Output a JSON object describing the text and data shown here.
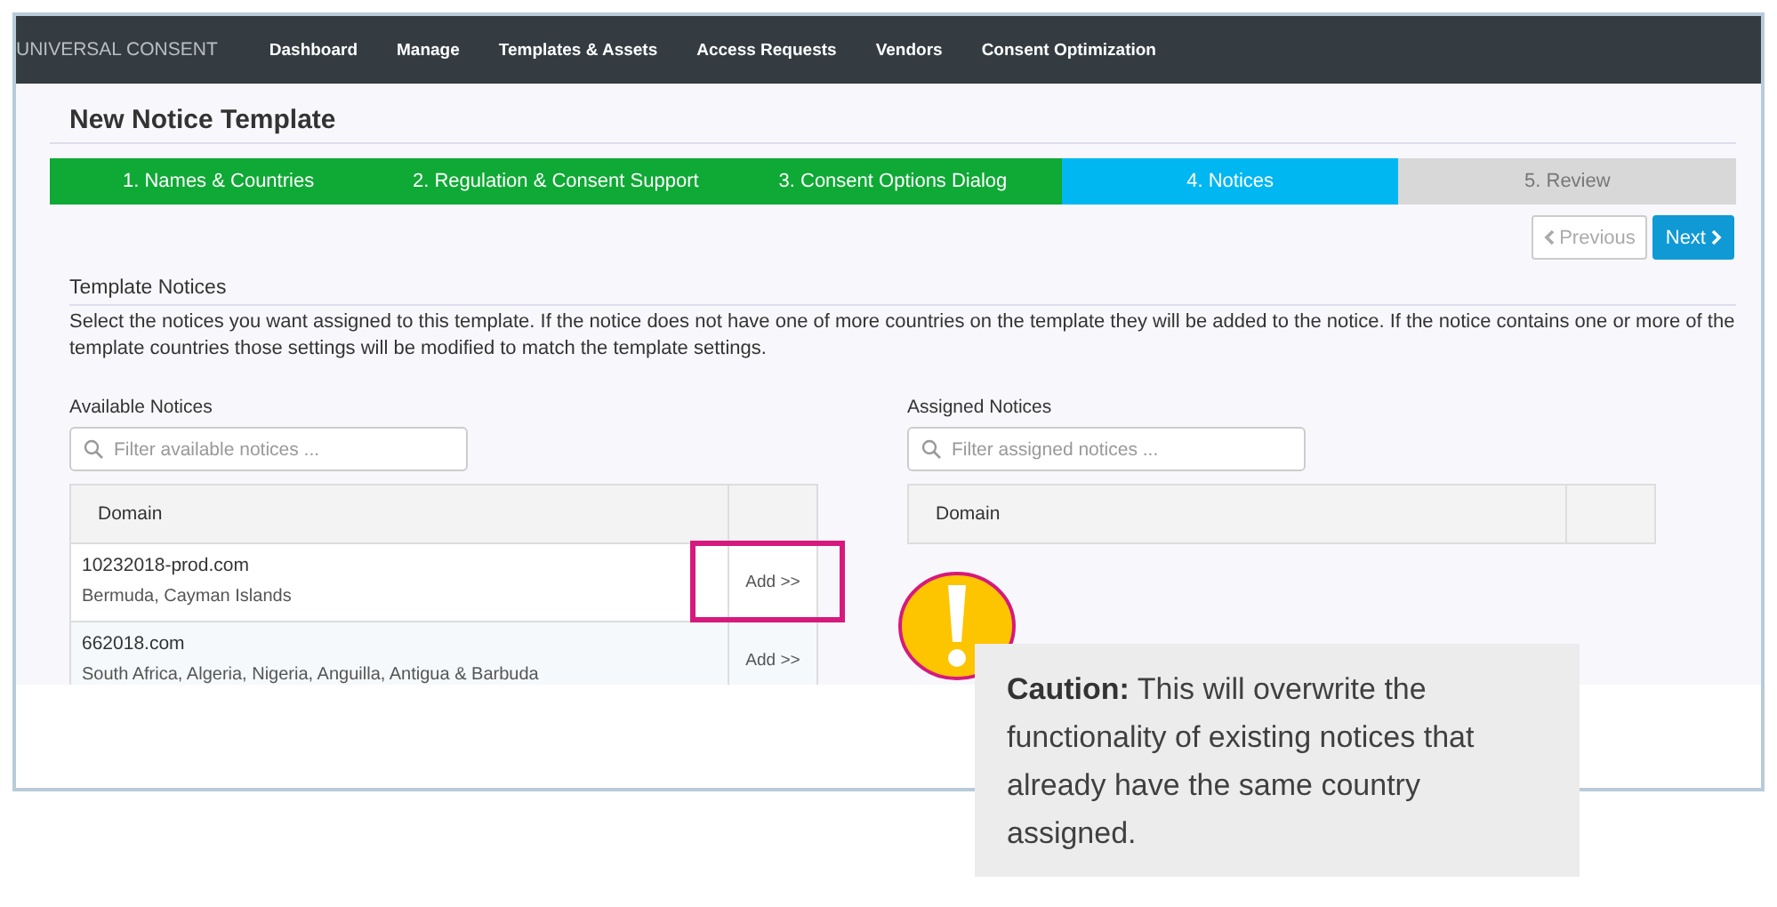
{
  "nav": {
    "brand": "UNIVERSAL CONSENT",
    "items": [
      "Dashboard",
      "Manage",
      "Templates & Assets",
      "Access Requests",
      "Vendors",
      "Consent Optimization"
    ]
  },
  "page_title": "New Notice Template",
  "steps": [
    {
      "label": "1. Names & Countries",
      "completed": true,
      "selected": false
    },
    {
      "label": "2. Regulation & Consent Support",
      "completed": true,
      "selected": false
    },
    {
      "label": "3. Consent Options Dialog",
      "completed": true,
      "selected": false
    },
    {
      "label": "4. Notices",
      "completed": false,
      "selected": true
    },
    {
      "label": "5. Review",
      "completed": false,
      "selected": false
    }
  ],
  "previous_button": {
    "label": "Previous",
    "disabled": true
  },
  "next_button": {
    "label": "Next",
    "disabled": false
  },
  "section": {
    "title": "Template Notices",
    "description": "Select the notices you want assigned to this template. If the notice does not have one of more countries on the template they will be added to the notice. If the notice contains one or more of the template countries those settings will be modified to match the template settings."
  },
  "available": {
    "title": "Available Notices",
    "placeholder": "Filter available notices ...",
    "columns": [
      "Domain"
    ],
    "rows": [
      {
        "domain": "10232018-prod.com",
        "countries": "Bermuda, Cayman Islands",
        "action": "Add >>",
        "highlighted": true
      },
      {
        "domain": "662018.com",
        "countries": "South Africa, Algeria, Nigeria, Anguilla, Antigua & Barbuda",
        "action": "Add >>",
        "highlighted": false
      }
    ]
  },
  "assigned": {
    "title": "Assigned Notices",
    "placeholder": "Filter assigned notices ...",
    "columns": [
      "Domain"
    ]
  },
  "callout": {
    "text": "**Caution:** This will overwrite the functionality of existing notices that already have the same country assigned."
  }
}
